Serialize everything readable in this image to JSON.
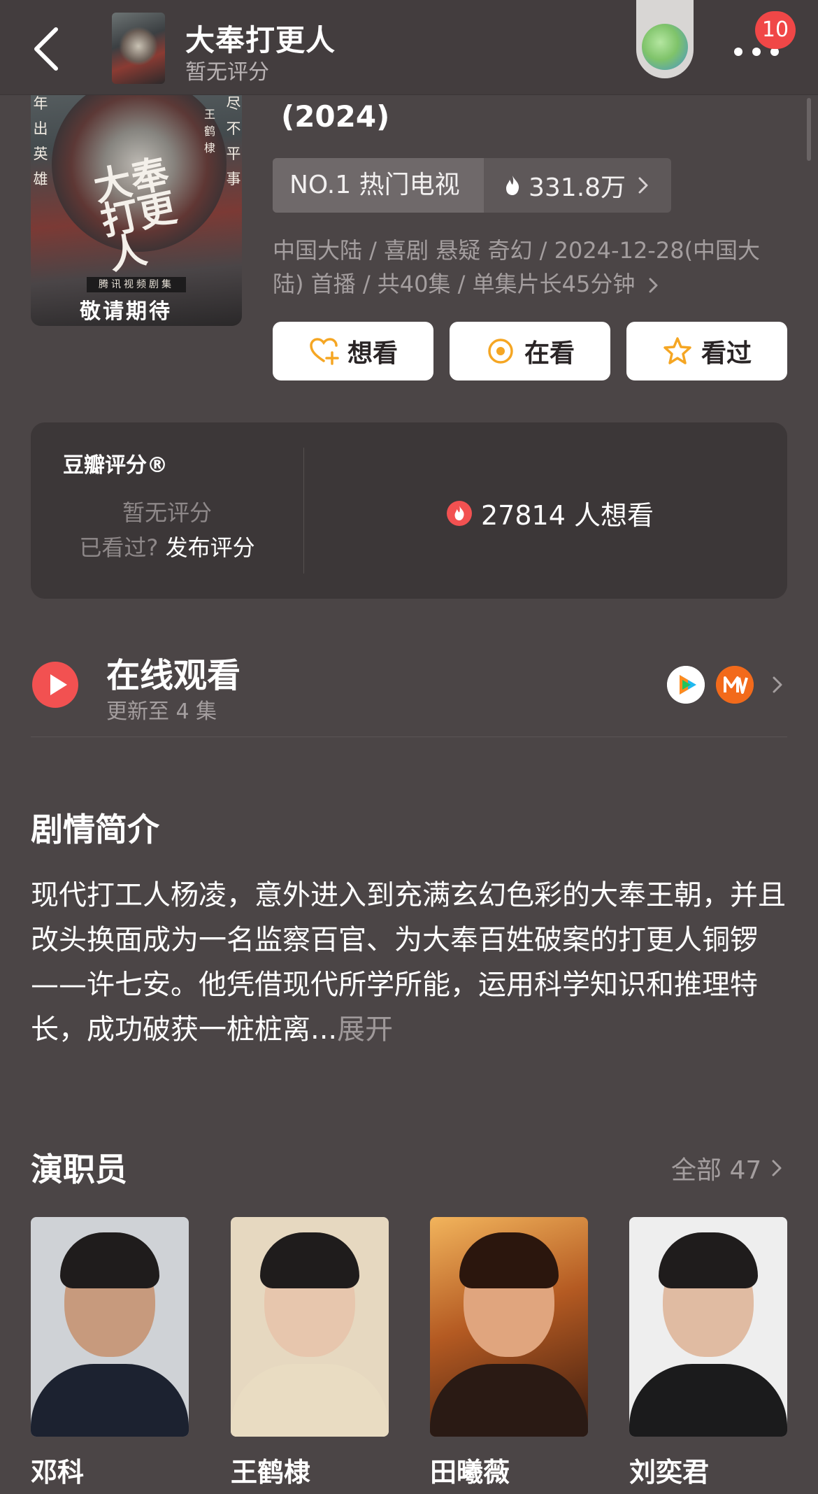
{
  "nav": {
    "title": "大奉打更人",
    "subtitle": "暂无评分",
    "badge_count": "10"
  },
  "header": {
    "year": "(2024)",
    "poster": {
      "side_text_left_1": "年",
      "side_text_left_2": "出",
      "side_text_left_3": "英",
      "side_text_left_4": "雄",
      "side_text_right_1": "尽",
      "side_text_right_2": "不",
      "side_text_right_3": "平",
      "side_text_right_4": "事",
      "cast_vertical": "王鹤棣",
      "calligraphy": "大奉打更人",
      "strip": "腾讯视频剧集",
      "expect": "敬请期待"
    },
    "rank_label": "NO.1 热门电视",
    "heat_value": "331.8万",
    "meta_line": "中国大陆 / 喜剧 悬疑 奇幻 / 2024-12-28(中国大陆) 首播 / 共40集 / 单集片长45分钟"
  },
  "actions": [
    {
      "label": "想看",
      "icon": "heart-plus-icon"
    },
    {
      "label": "在看",
      "icon": "target-icon"
    },
    {
      "label": "看过",
      "icon": "star-icon"
    }
  ],
  "rating": {
    "brand": "豆瓣评分®",
    "no_rating": "暂无评分",
    "watched_q": "已看过?",
    "publish": "发布评分",
    "want_count": "27814 人想看"
  },
  "watch": {
    "title": "在线观看",
    "subtitle": "更新至 4 集",
    "platform_1": "tencent-video-icon",
    "platform_2": "mango-tv-icon"
  },
  "synopsis": {
    "title": "剧情简介",
    "text": "现代打工人杨凌，意外进入到充满玄幻色彩的大奉王朝，并且改头换面成为一名监察百官、为大奉百姓破案的打更人铜锣——许七安。他凭借现代所学所能，运用科学知识和推理特长，成功破获一桩桩离...",
    "expand": "展开"
  },
  "cast": {
    "title": "演职员",
    "all_label": "全部 47",
    "members": [
      {
        "name": "邓科"
      },
      {
        "name": "王鹤棣"
      },
      {
        "name": "田曦薇"
      },
      {
        "name": "刘奕君"
      }
    ]
  },
  "colors": {
    "background": "#4b4546",
    "accent_red": "#f25151",
    "action_icon": "#f5a623"
  }
}
